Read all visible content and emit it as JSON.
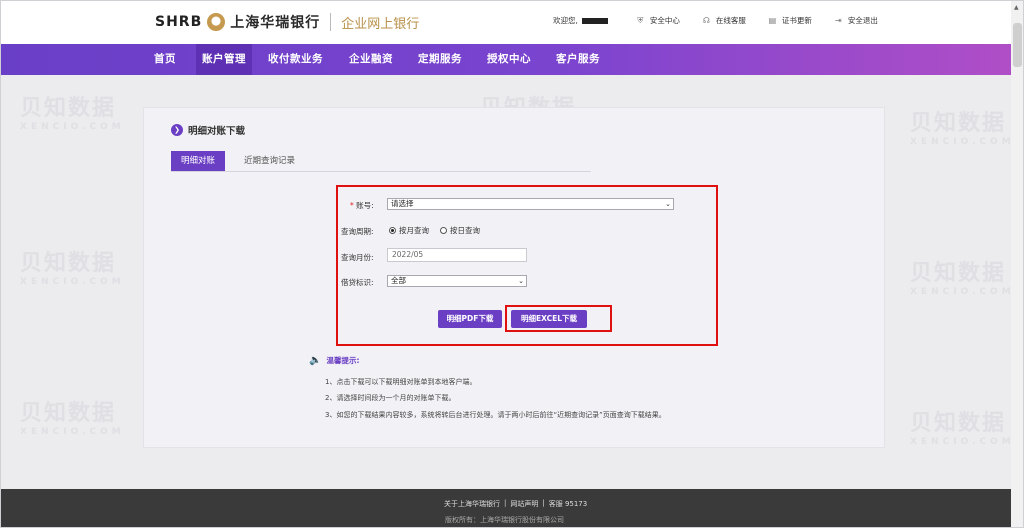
{
  "header": {
    "logo_latin": "SHRB",
    "logo_cn": "上海华瑞银行",
    "logo_sub": "企业网上银行",
    "welcome": "欢迎您,",
    "links": [
      {
        "label": "安全中心",
        "icon": "shield-icon"
      },
      {
        "label": "在线客服",
        "icon": "headset-icon"
      },
      {
        "label": "证书更新",
        "icon": "certificate-icon"
      },
      {
        "label": "安全退出",
        "icon": "logout-icon"
      }
    ]
  },
  "nav": {
    "items": [
      "首页",
      "账户管理",
      "收付款业务",
      "企业融资",
      "定期服务",
      "授权中心",
      "客户服务"
    ],
    "active": "账户管理"
  },
  "page": {
    "title": "明细对账下载",
    "tabs": [
      "明细对账",
      "近期查询记录"
    ]
  },
  "form": {
    "account_label": "账号:",
    "account_value": "请选择",
    "period_label": "查询周期:",
    "period_options": [
      "按月查询",
      "按日查询"
    ],
    "month_label": "查询月份:",
    "month_value": "2022/05",
    "flag_label": "借贷标识:",
    "flag_value": "全部",
    "pdf_button": "明细PDF下载",
    "excel_button": "明细EXCEL下载"
  },
  "tips": {
    "title": "温馨提示:",
    "items": [
      "1、点击下载可以下载明细对账单到本地客户端。",
      "2、请选择时间段为一个月的对账单下载。",
      "3、如您的下载结果内容较多，系统将转后台进行处理。请于两小时后前往“近期查询记录”页面查询下载结果。"
    ]
  },
  "footer": {
    "links": [
      "关于上海华瑞银行",
      "网站声明",
      "客服 95173"
    ],
    "copyright": "版权所有：上海华瑞银行股份有限公司"
  },
  "watermark": {
    "cn": "贝知数据",
    "latin": "XENCIO.COM"
  },
  "colors": {
    "brand_purple": "#6b3fc4",
    "highlight_red": "#e01010"
  }
}
